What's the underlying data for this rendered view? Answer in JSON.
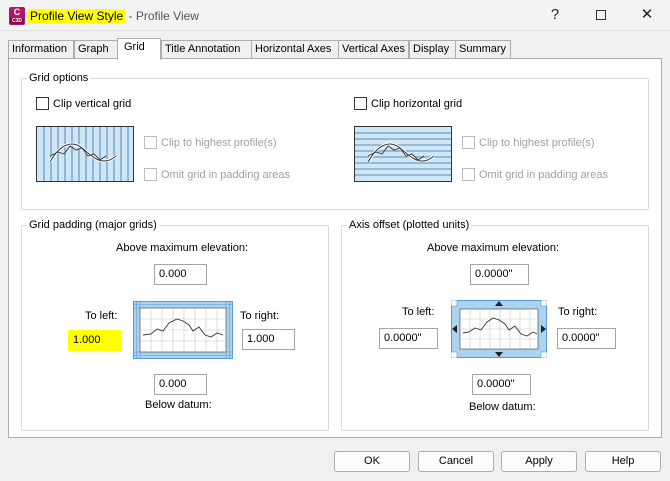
{
  "window": {
    "icon_letter": "C",
    "icon_sub": "C3D",
    "title_highlight": "Profile View Style",
    "title_rest": " - Profile View",
    "help_label": "?",
    "close_label": "✕"
  },
  "tabs": [
    {
      "label": "Information",
      "active": false
    },
    {
      "label": "Graph",
      "active": false
    },
    {
      "label": "Grid",
      "active": true
    },
    {
      "label": "Title Annotation",
      "active": false
    },
    {
      "label": "Horizontal Axes",
      "active": false
    },
    {
      "label": "Vertical Axes",
      "active": false
    },
    {
      "label": "Display",
      "active": false
    },
    {
      "label": "Summary",
      "active": false
    }
  ],
  "grid_options": {
    "legend": "Grid options",
    "clip_vertical": {
      "label": "Clip vertical grid",
      "checked": false
    },
    "clip_horizontal": {
      "label": "Clip horizontal grid",
      "checked": false
    },
    "left_clip_highest": {
      "label": "Clip to highest profile(s)",
      "enabled": false
    },
    "left_omit_padding": {
      "label": "Omit grid in padding areas",
      "enabled": false
    },
    "right_clip_highest": {
      "label": "Clip to highest profile(s)",
      "enabled": false
    },
    "right_omit_padding": {
      "label": "Omit grid in padding areas",
      "enabled": false
    }
  },
  "grid_padding": {
    "legend": "Grid padding (major grids)",
    "above_label": "Above maximum elevation:",
    "above_value": "0.000",
    "left_label": "To left:",
    "left_value": "1.000",
    "right_label": "To right:",
    "right_value": "1.000",
    "below_value": "0.000",
    "below_label": "Below datum:"
  },
  "axis_offset": {
    "legend": "Axis offset (plotted units)",
    "above_label": "Above maximum elevation:",
    "above_value": "0.0000\"",
    "left_label": "To left:",
    "left_value": "0.0000\"",
    "right_label": "To right:",
    "right_value": "0.0000\"",
    "below_value": "0.0000\"",
    "below_label": "Below datum:"
  },
  "buttons": {
    "ok": "OK",
    "cancel": "Cancel",
    "apply": "Apply",
    "help": "Help"
  },
  "colors": {
    "highlight": "#ffff00",
    "preview_blue": "#a9d3f0",
    "preview_blue_dark": "#5b9bd5"
  }
}
